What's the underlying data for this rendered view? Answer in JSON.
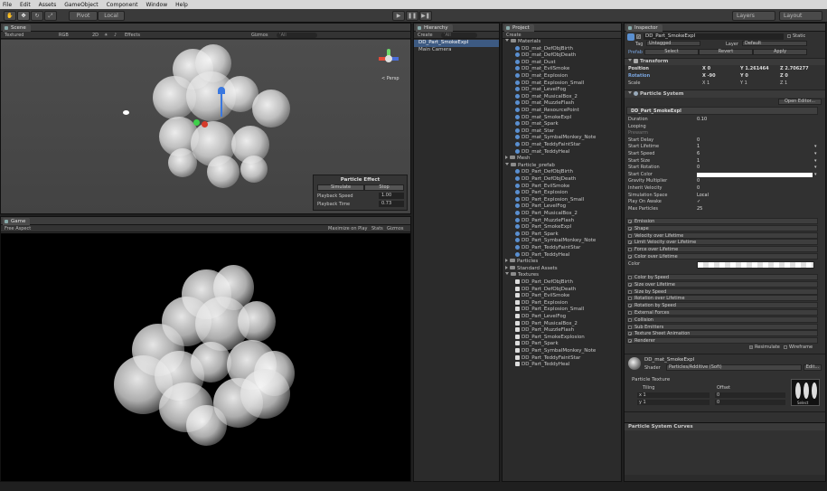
{
  "menu": [
    "File",
    "Edit",
    "Assets",
    "GameObject",
    "Component",
    "Window",
    "Help"
  ],
  "toolbar": {
    "pivot": "Pivot",
    "local": "Local",
    "layers": "Layers",
    "layout": "Layout"
  },
  "scene": {
    "tab": "Scene",
    "sub": {
      "shading": "Textured",
      "mode": "RGB",
      "twod": "2D",
      "effects": "Effects",
      "gizmos": "Gizmos",
      "search": "‘All"
    },
    "persp": "< Persp",
    "overlay": {
      "title": "Particle Effect",
      "simulate": "Simulate",
      "stop": "Stop",
      "speed_label": "Playback Speed",
      "speed_value": "1.00",
      "time_label": "Playback Time",
      "time_value": "0.73"
    }
  },
  "game": {
    "tab": "Game",
    "sub": {
      "aspect": "Free Aspect",
      "maximize": "Maximize on Play",
      "stats": "Stats",
      "gizmos": "Gizmos"
    }
  },
  "hierarchy": {
    "tab": "Hierarchy",
    "create": "Create",
    "search": "‘All",
    "items": [
      "DD_Part_SmokeExpl",
      "Main Camera"
    ]
  },
  "project": {
    "tab": "Project",
    "create": "Create",
    "materials_folder": "Materials",
    "materials": [
      "DD_mat_DefObjBirth",
      "DD_mat_DefObjDeath",
      "DD_mat_Dust",
      "DD_mat_EvilSmoke",
      "DD_mat_Explosion",
      "DD_mat_Explosion_Small",
      "DD_mat_LevelFog",
      "DD_mat_MusicalBox_2",
      "DD_mat_MuzzleFlash",
      "DD_mat_ResourcePoint",
      "DD_mat_SmokeExpl",
      "DD_mat_Spark",
      "DD_mat_Star",
      "DD_mat_SymbalMonkey_Note",
      "DD_mat_TeddyFaintStar",
      "DD_mat_TeddyHeal"
    ],
    "mesh_folder": "Mesh",
    "prefab_folder": "Particle_prefab",
    "prefabs": [
      "DD_Part_DefObjBirth",
      "DD_Part_DefObjDeath",
      "DD_Part_EvilSmoke",
      "DD_Part_Explosion",
      "DD_Part_Explosion_Small",
      "DD_Part_LevelFog",
      "DD_Part_MusicalBox_2",
      "DD_Part_MuzzleFlash",
      "DD_Part_SmokeExpl",
      "DD_Part_Spark",
      "DD_Part_SymbalMonkey_Note",
      "DD_Part_TeddyFaintStar",
      "DD_Part_TeddyHeal"
    ],
    "particles_folder": "Particles",
    "standard_folder": "Standard Assets",
    "textures_folder": "Textures",
    "textures": [
      "DD_Part_DefObjBirth",
      "DD_Part_DefObjDeath",
      "DD_Part_EvilSmoke",
      "DD_Part_Explosion",
      "DD_Part_Explosion_Small",
      "DD_Part_LevelFog",
      "DD_Part_MusicalBox_2",
      "DD_Part_MuzzleFlash",
      "DD_Part_SmokeExplosion",
      "DD_Part_Spark",
      "DD_Part_SymbalMonkey_Note",
      "DD_Part_TeddyFaintStar",
      "DD_Part_TeddyHeal"
    ]
  },
  "inspector": {
    "tab": "Inspector",
    "name": "DD_Part_SmokeExpl",
    "static": "Static",
    "tag_label": "Tag",
    "tag": "Untagged",
    "layer_label": "Layer",
    "layer": "Default",
    "prefab": "Prefab",
    "select": "Select",
    "revert": "Revert",
    "apply": "Apply",
    "transform": "Transform",
    "position_label": "Position",
    "position": {
      "x": "X 0",
      "y": "Y 1.261464",
      "z": "Z 2.706277"
    },
    "rotation_label": "Rotation",
    "rotation": {
      "x": "X -90",
      "y": "Y 0",
      "z": "Z 0"
    },
    "scale_label": "Scale",
    "scale": {
      "x": "X 1",
      "y": "Y 1",
      "z": "Z 1"
    },
    "ps": "Particle System",
    "open_editor": "Open Editor...",
    "ps_name": "DD_Part_SmokeExpl",
    "props": [
      {
        "k": "Duration",
        "v": "0.10"
      },
      {
        "k": "Looping",
        "v": ""
      },
      {
        "k": "Prewarm",
        "v": ""
      },
      {
        "k": "Start Delay",
        "v": "0"
      },
      {
        "k": "Start Lifetime",
        "v": "1"
      },
      {
        "k": "Start Speed",
        "v": "6"
      },
      {
        "k": "Start Size",
        "v": "1"
      },
      {
        "k": "Start Rotation",
        "v": "0"
      },
      {
        "k": "Start Color",
        "v": ""
      },
      {
        "k": "Gravity Multiplier",
        "v": "0"
      },
      {
        "k": "Inherit Velocity",
        "v": "0"
      },
      {
        "k": "Simulation Space",
        "v": "Local"
      },
      {
        "k": "Play On Awake",
        "v": "✓"
      },
      {
        "k": "Max Particles",
        "v": "25"
      }
    ],
    "modules_a": [
      {
        "name": "Emission",
        "on": true
      },
      {
        "name": "Shape",
        "on": true
      },
      {
        "name": "Velocity over Lifetime",
        "on": false
      },
      {
        "name": "Limit Velocity over Lifetime",
        "on": true
      },
      {
        "name": "Force over Lifetime",
        "on": false
      },
      {
        "name": "Color over Lifetime",
        "on": true
      }
    ],
    "color_label": "Color",
    "modules_b": [
      {
        "name": "Color by Speed",
        "on": false
      },
      {
        "name": "Size over Lifetime",
        "on": true
      },
      {
        "name": "Size by Speed",
        "on": false
      },
      {
        "name": "Rotation over Lifetime",
        "on": false
      },
      {
        "name": "Rotation by Speed",
        "on": true
      },
      {
        "name": "External Forces",
        "on": false
      },
      {
        "name": "Collision",
        "on": false
      },
      {
        "name": "Sub Emitters",
        "on": false
      },
      {
        "name": "Texture Sheet Animation",
        "on": true
      },
      {
        "name": "Renderer",
        "on": true
      }
    ],
    "resimulate": "Resimulate",
    "wireframe": "Wireframe",
    "material": "DD_mat_SmokeExpl",
    "shader_label": "Shader",
    "shader": "Particles/Additive (Soft)",
    "edit": "Edit...",
    "particle_texture": "Particle Texture",
    "tiling": "Tiling",
    "offset": "Offset",
    "tx_x": "x 1",
    "tx_y": "y 1",
    "of_x": "0",
    "of_y": "0",
    "select_btn": "Select",
    "curves": "Particle System Curves"
  }
}
